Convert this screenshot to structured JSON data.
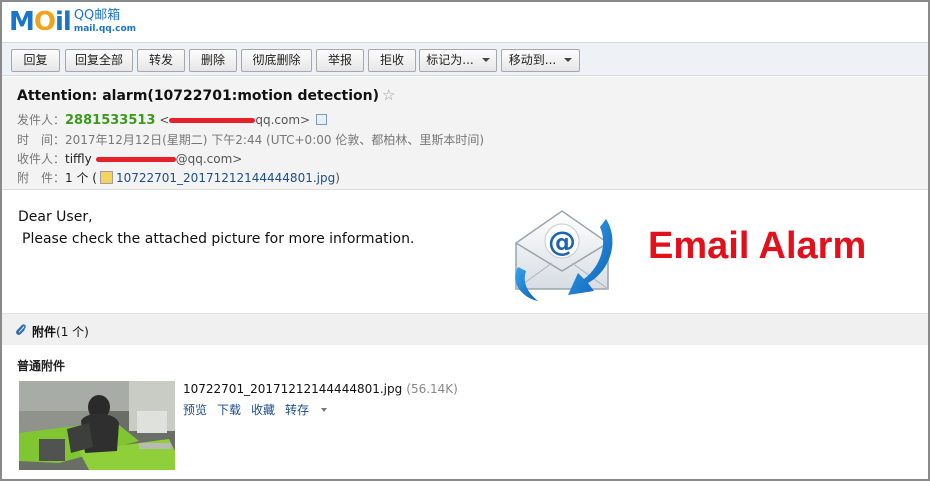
{
  "brand": {
    "logo_m": "M",
    "logo_o": "O",
    "logo_il": "il",
    "logo_qq": "QQ邮箱",
    "logo_url": "mail.qq.com"
  },
  "toolbar": {
    "reply": "回复",
    "reply_all": "回复全部",
    "forward": "转发",
    "delete": "删除",
    "delete_permanently": "彻底删除",
    "report": "举报",
    "reject": "拒收",
    "mark_as": "标记为...",
    "move_to": "移动到..."
  },
  "mail": {
    "subject": "Attention: alarm(10722701:motion detection)",
    "star": "☆",
    "from_label": "发件人：",
    "from_name": "2881533513",
    "from_addr_open": "<",
    "from_addr_domain": "qq.com>",
    "time_label": "时　间：",
    "time_value": "2017年12月12日(星期二) 下午2:44 (UTC+0:00 伦敦、都柏林、里斯本时间)",
    "to_label": "收件人：",
    "to_name": "tiffly",
    "to_addr_domain": "@qq.com>",
    "attach_label": "附　件：",
    "attach_count_prefix": "1 个 (",
    "attach_file": "10722701_20171212144444801.jpg",
    "attach_count_suffix": ")"
  },
  "body": {
    "greeting": "Dear User,",
    "message": "Please check the attached picture for more information.",
    "alarm_banner": "Email Alarm",
    "envelope_symbol": "@"
  },
  "attachments": {
    "header_label": "附件",
    "header_count": "(1 个)",
    "section_type": "普通附件",
    "file_name": "10722701_20171212144444801.jpg",
    "file_size": "(56.14K)",
    "actions": {
      "preview": "预览",
      "download": "下载",
      "favorite": "收藏",
      "save_to": "转存"
    }
  }
}
